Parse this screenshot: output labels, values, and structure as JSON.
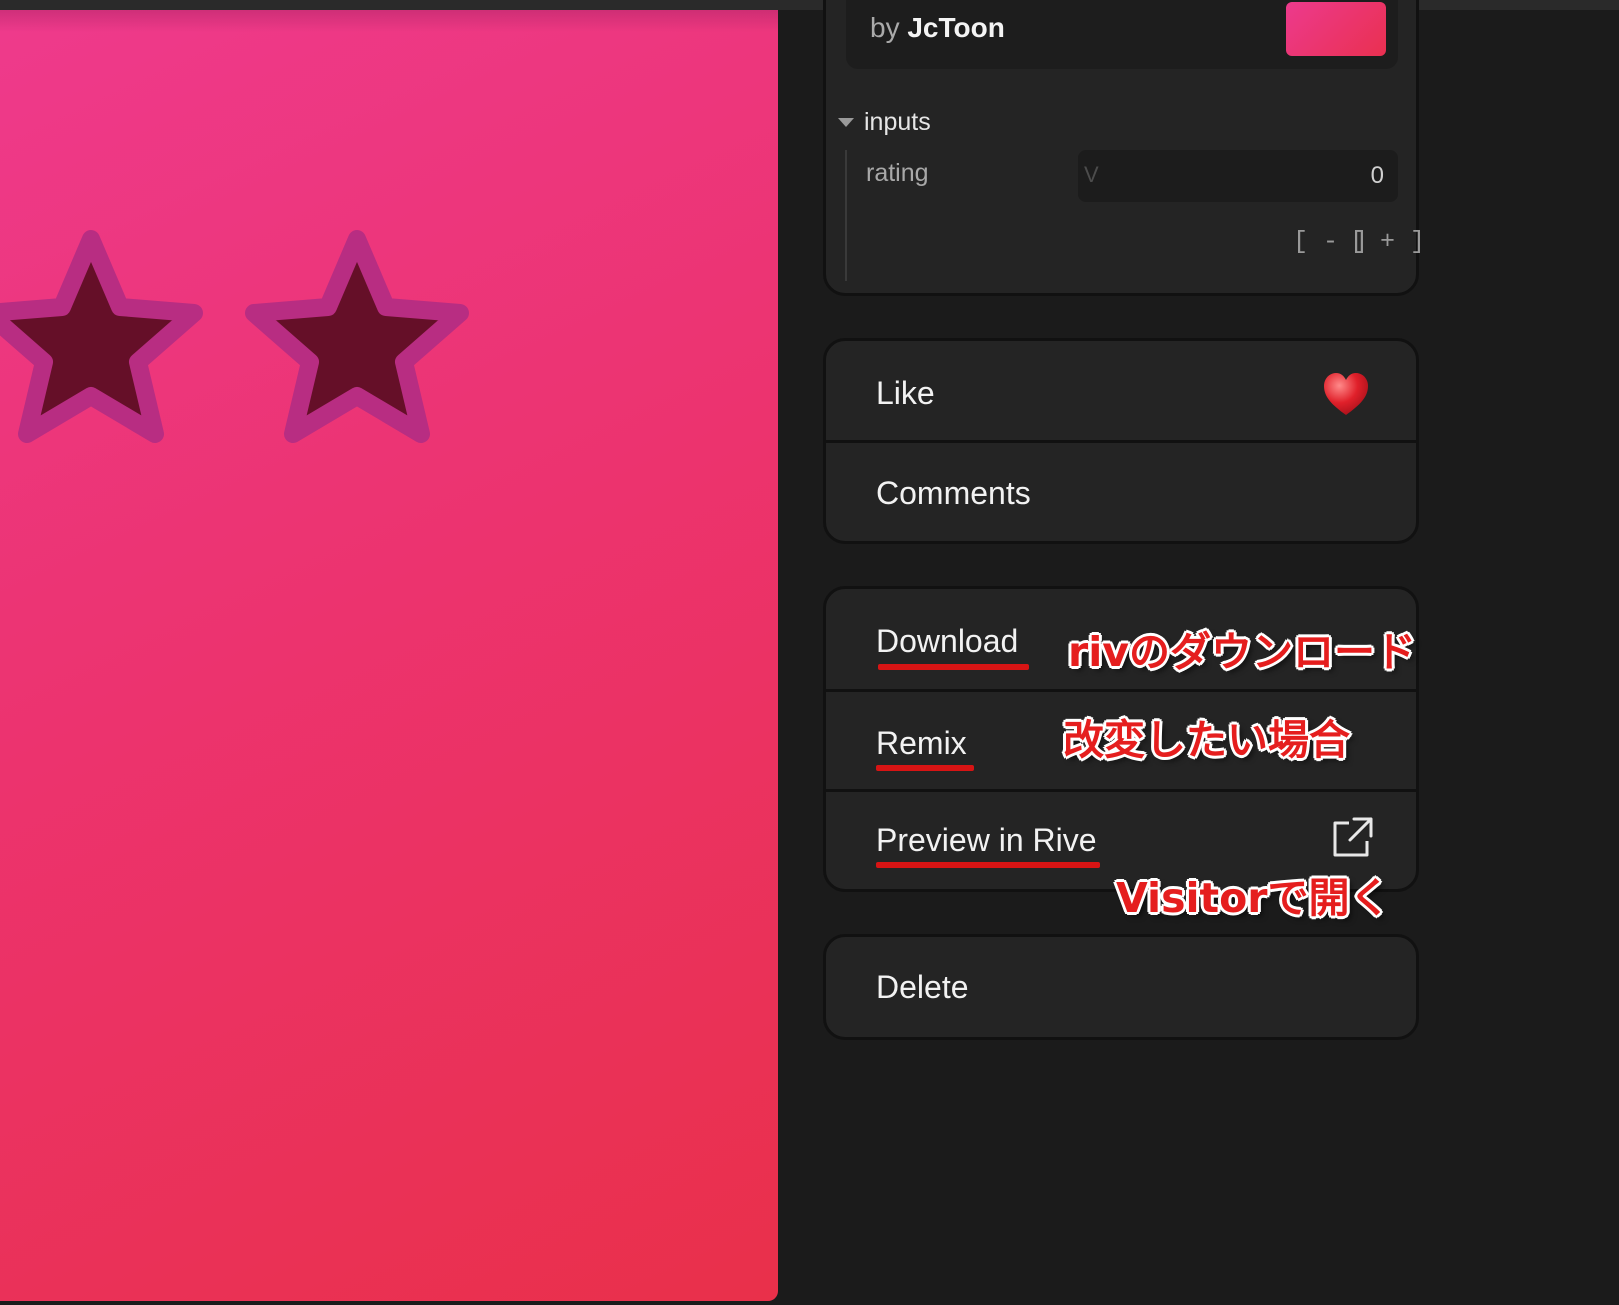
{
  "author": {
    "prefix": "by",
    "name": "JcToon"
  },
  "inputs": {
    "title": "inputs",
    "rating": {
      "label": "rating",
      "placeholder": "V",
      "value": "0"
    },
    "decrement": "[ - ]",
    "increment": "[ + ]"
  },
  "social": {
    "like": "Like",
    "comments": "Comments"
  },
  "actions": {
    "download": "Download",
    "remix": "Remix",
    "preview": "Preview in Rive"
  },
  "danger": {
    "delete": "Delete"
  },
  "annotations": {
    "download": "rivのダウンロード",
    "remix": "改変したい場合",
    "preview": "Visitorで開く"
  },
  "colors": {
    "accent_red": "#d71414",
    "preview_gradient_start": "#ee3a8c",
    "preview_gradient_end": "#e9304a",
    "star_fill": "#650f28",
    "star_outline": "#b82d82"
  },
  "icons": [
    "star-icon",
    "heart-icon",
    "external-link-icon",
    "caret-down-icon"
  ]
}
